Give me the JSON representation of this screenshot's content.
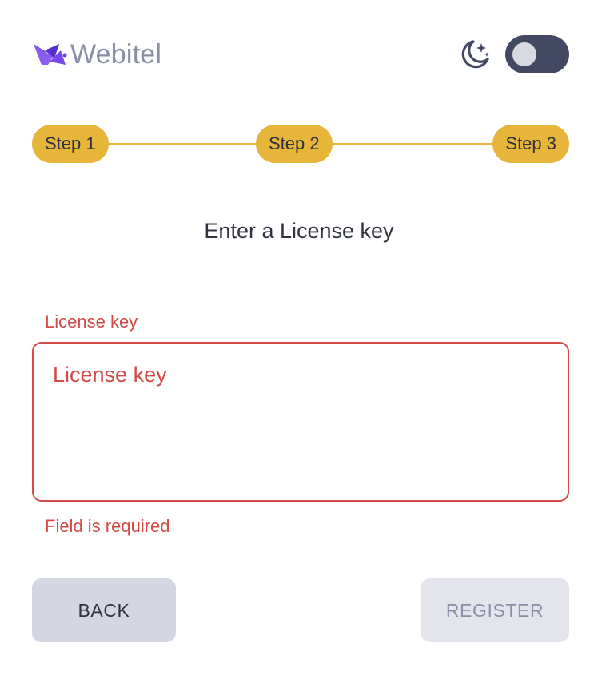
{
  "header": {
    "logo_text": "Webitel",
    "logo_icon": "webitel-logo-icon",
    "theme_icon": "moon-stars-icon",
    "dark_mode_enabled": false
  },
  "stepper": {
    "steps": [
      {
        "label": "Step 1"
      },
      {
        "label": "Step 2"
      },
      {
        "label": "Step 3"
      }
    ]
  },
  "main": {
    "title": "Enter a License key",
    "field": {
      "label": "License key",
      "placeholder": "License key",
      "value": "",
      "error": "Field is required"
    }
  },
  "actions": {
    "back_label": "BACK",
    "register_label": "REGISTER"
  },
  "colors": {
    "accent": "#e6b53a",
    "error": "#d14a45",
    "logo_purple": "#6b3fe0",
    "toggle_bg": "#434963"
  }
}
